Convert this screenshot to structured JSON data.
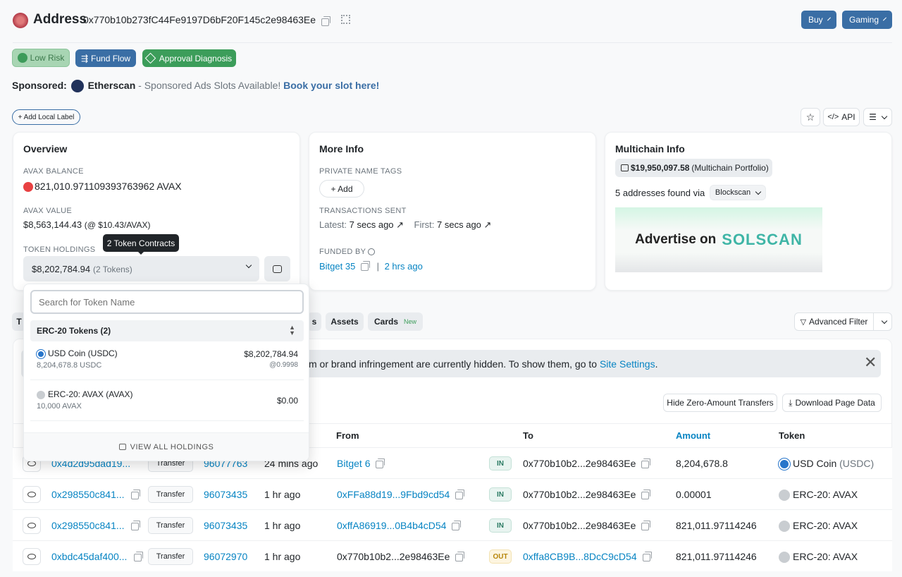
{
  "header": {
    "title": "Address",
    "address": "0x770b10b273fC44Fe9197D6bF20F145c2e98463Ee",
    "buy_label": "Buy",
    "gaming_label": "Gaming"
  },
  "badges": {
    "low_risk": "Low Risk",
    "fund_flow": "Fund Flow",
    "approval": "Approval Diagnosis"
  },
  "sponsored": {
    "prefix": "Sponsored:",
    "brand": "Etherscan",
    "text": "- Sponsored Ads Slots Available!",
    "cta": "Book your slot here!"
  },
  "actions": {
    "add_label": "+ Add Local Label",
    "api": "API"
  },
  "overview": {
    "title": "Overview",
    "balance_label": "AVAX BALANCE",
    "balance": "821,010.971109393763962 AVAX",
    "value_label": "AVAX VALUE",
    "value": "$8,563,144.43",
    "value_rate": "(@ $10.43/AVAX)",
    "holdings_label": "TOKEN HOLDINGS",
    "tooltip": "2 Token Contracts",
    "holdings_value": "$8,202,784.94",
    "holdings_count": "(2 Tokens)"
  },
  "dropdown": {
    "search_placeholder": "Search for Token Name",
    "group": "ERC-20 Tokens (2)",
    "tokens": [
      {
        "name": "USD Coin (USDC)",
        "amount": "8,204,678.8 USDC",
        "value": "$8,202,784.94",
        "rate": "@0.9998"
      },
      {
        "name": "ERC-20: AVAX (AVAX)",
        "amount": "10,000 AVAX",
        "value": "$0.00",
        "rate": ""
      }
    ],
    "view_all": "VIEW ALL HOLDINGS"
  },
  "more_info": {
    "title": "More Info",
    "tags_label": "PRIVATE NAME TAGS",
    "add": "+ Add",
    "tx_label": "TRANSACTIONS SENT",
    "latest_label": "Latest:",
    "latest": "7 secs ago",
    "first_label": "First:",
    "first": "7 secs ago",
    "funded_label": "FUNDED BY",
    "funded_by": "Bitget 35",
    "funded_time": "2 hrs ago"
  },
  "multichain": {
    "title": "Multichain Info",
    "portfolio_value": "$19,950,097.58",
    "portfolio_label": "(Multichain Portfolio)",
    "found_text": "5 addresses found via",
    "select": "Blockscan",
    "ad_text": "Advertise on",
    "ad_brand": "SOLSCAN"
  },
  "tabs": {
    "partial": "T",
    "partial2": "s",
    "assets": "Assets",
    "cards": "Cards",
    "cards_badge": "New",
    "advanced_filter": "Advanced Filter"
  },
  "notice": {
    "text": "m or brand infringement are currently hidden. To show them, go to",
    "link": "Site Settings",
    "suffix": "."
  },
  "table_tools": {
    "hide_zero": "Hide Zero-Amount Transfers",
    "download": "Download Page Data"
  },
  "table": {
    "headers": {
      "from": "From",
      "to": "To",
      "amount": "Amount",
      "token": "Token"
    },
    "rows": [
      {
        "hash": "0x4d2d95dad19...",
        "method": "Transfer",
        "block": "96077763",
        "age": "24 mins ago",
        "from": "Bitget 6",
        "dir": "IN",
        "to": "0x770b10b2...2e98463Ee",
        "amount": "8,204,678.8",
        "token": "USD Coin",
        "token_sym": "(USDC)"
      },
      {
        "hash": "0x298550c841...",
        "method": "Transfer",
        "block": "96073435",
        "age": "1 hr ago",
        "from": "0xFFa88d19...9Fbd9cd54",
        "dir": "IN",
        "to": "0x770b10b2...2e98463Ee",
        "amount": "0.00001",
        "token": "ERC-20: AVAX",
        "token_sym": ""
      },
      {
        "hash": "0x298550c841...",
        "method": "Transfer",
        "block": "96073435",
        "age": "1 hr ago",
        "from": "0xffA86919...0B4b4cD54",
        "dir": "IN",
        "to": "0x770b10b2...2e98463Ee",
        "amount": "821,011.97114246",
        "token": "ERC-20: AVAX",
        "token_sym": ""
      },
      {
        "hash": "0xbdc45daf400...",
        "method": "Transfer",
        "block": "96072970",
        "age": "1 hr ago",
        "from": "0x770b10b2...2e98463Ee",
        "dir": "OUT",
        "to": "0xffa8CB9B...8DcC9cD54",
        "amount": "821,011.97114246",
        "token": "ERC-20: AVAX",
        "token_sym": ""
      }
    ]
  }
}
